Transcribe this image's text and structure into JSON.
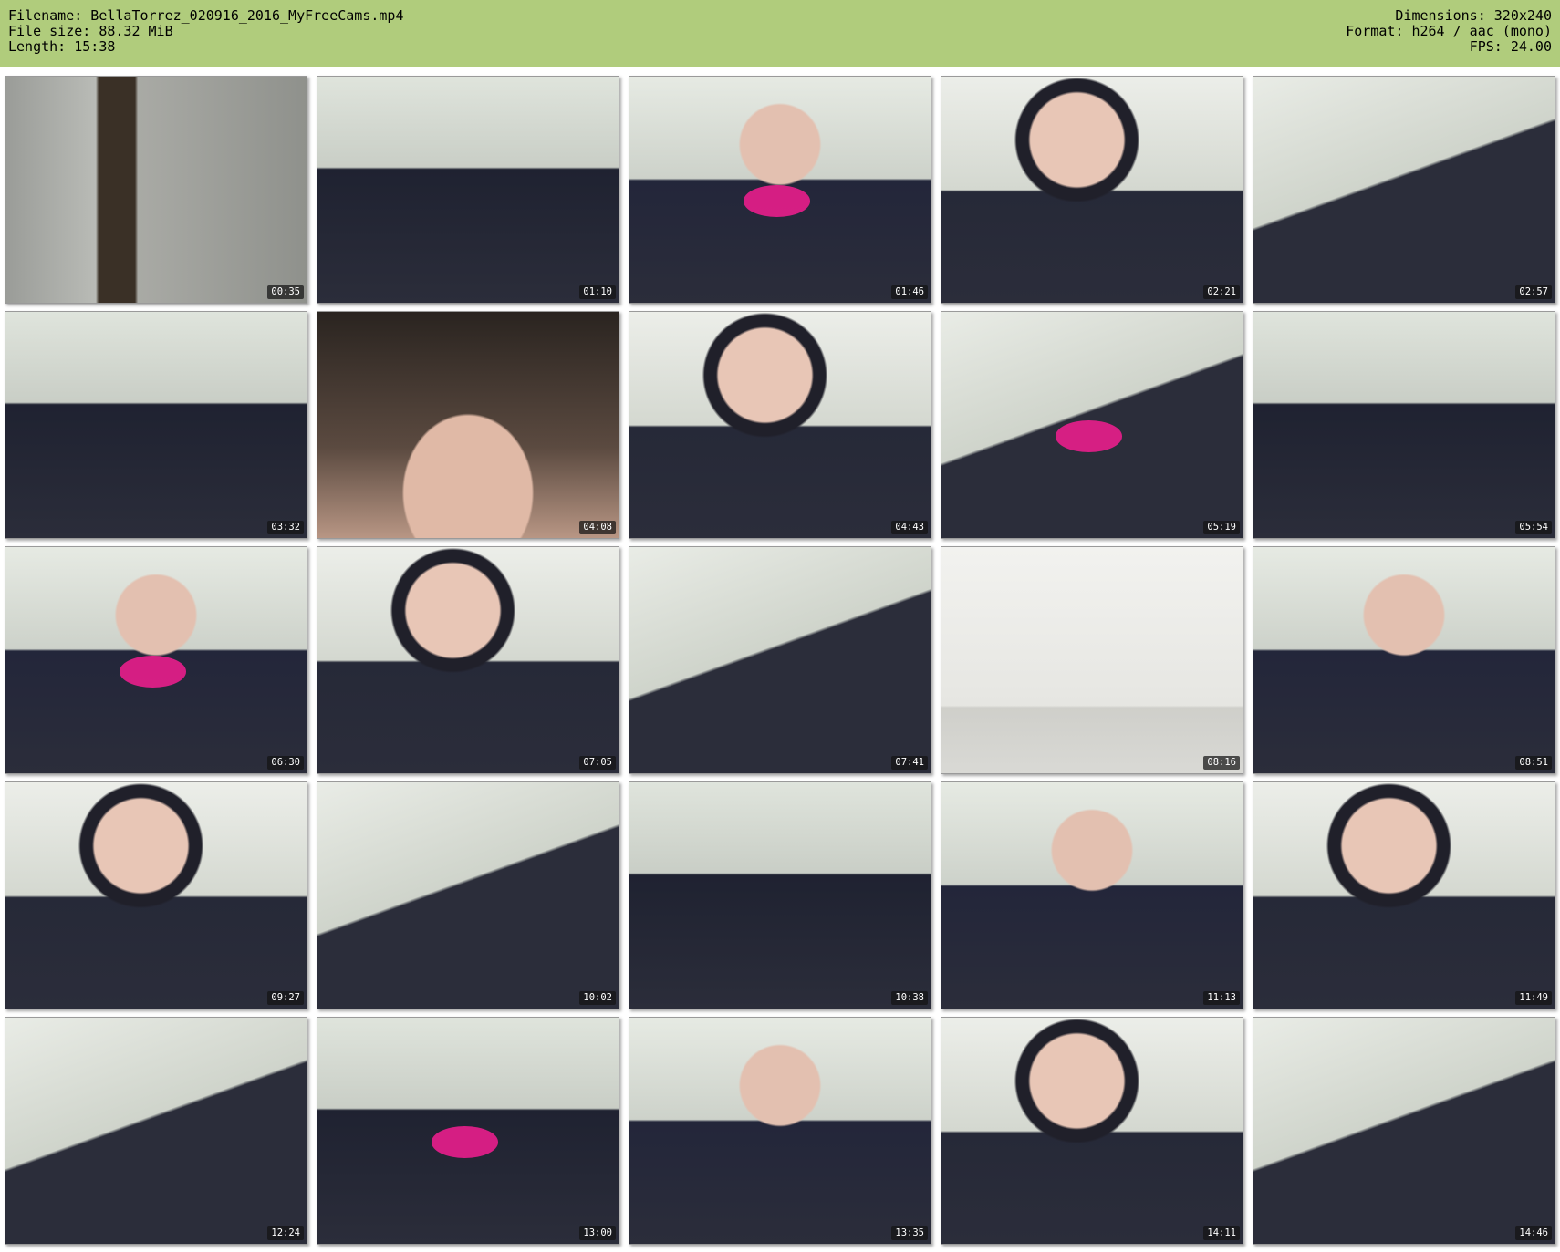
{
  "header": {
    "filename_line": "Filename: BellaTorrez_020916_2016_MyFreeCams.mp4",
    "filesize_line": "File size: 88.32 MiB",
    "length_line": "Length: 15:38",
    "dimensions_line": "Dimensions: 320x240",
    "format_line": "Format: h264 / aac (mono)",
    "fps_line": "FPS: 24.00"
  },
  "colors": {
    "header_bg": "#b0cc7c",
    "page_bg": "#ffffff",
    "frame_dark": "#2b2d3a",
    "frame_light": "#d9ddd6",
    "accent_pink": "#e91e8c"
  },
  "thumbnails": [
    {
      "time": "00:35"
    },
    {
      "time": "01:10"
    },
    {
      "time": "01:46"
    },
    {
      "time": "02:21"
    },
    {
      "time": "02:57"
    },
    {
      "time": "03:32"
    },
    {
      "time": "04:08"
    },
    {
      "time": "04:43"
    },
    {
      "time": "05:19"
    },
    {
      "time": "05:54"
    },
    {
      "time": "06:30"
    },
    {
      "time": "07:05"
    },
    {
      "time": "07:41"
    },
    {
      "time": "08:16"
    },
    {
      "time": "08:51"
    },
    {
      "time": "09:27"
    },
    {
      "time": "10:02"
    },
    {
      "time": "10:38"
    },
    {
      "time": "11:13"
    },
    {
      "time": "11:49"
    },
    {
      "time": "12:24"
    },
    {
      "time": "13:00"
    },
    {
      "time": "13:35"
    },
    {
      "time": "14:11"
    },
    {
      "time": "14:46"
    }
  ]
}
